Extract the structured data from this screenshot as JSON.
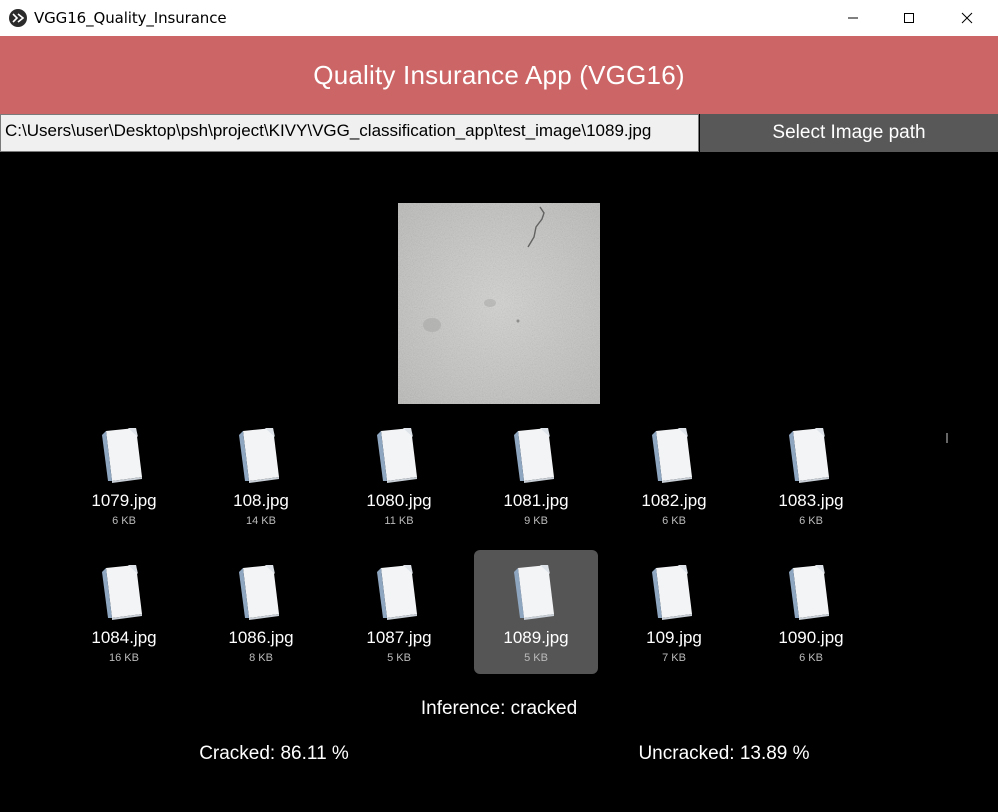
{
  "window": {
    "title": "VGG16_Quality_Insurance",
    "app_icon": "kivy-icon",
    "controls": [
      "minimize-icon",
      "maximize-icon",
      "close-icon"
    ]
  },
  "header": {
    "title": "Quality Insurance App (VGG16)",
    "background": "#cc6666"
  },
  "path_bar": {
    "value": "C:\\Users\\user\\Desktop\\psh\\project\\KIVY\\VGG_classification_app\\test_image\\1089.jpg",
    "button_label": "Select Image path"
  },
  "preview": {
    "icon": "concrete-texture-image"
  },
  "files": [
    {
      "name": "1079.jpg",
      "size": "6 KB",
      "selected": false
    },
    {
      "name": "108.jpg",
      "size": "14 KB",
      "selected": false
    },
    {
      "name": "1080.jpg",
      "size": "11 KB",
      "selected": false
    },
    {
      "name": "1081.jpg",
      "size": "9 KB",
      "selected": false
    },
    {
      "name": "1082.jpg",
      "size": "6 KB",
      "selected": false
    },
    {
      "name": "1083.jpg",
      "size": "6 KB",
      "selected": false
    },
    {
      "name": "1084.jpg",
      "size": "16 KB",
      "selected": false
    },
    {
      "name": "1086.jpg",
      "size": "8 KB",
      "selected": false
    },
    {
      "name": "1087.jpg",
      "size": "5 KB",
      "selected": false
    },
    {
      "name": "1089.jpg",
      "size": "5 KB",
      "selected": true
    },
    {
      "name": "109.jpg",
      "size": "7 KB",
      "selected": false
    },
    {
      "name": "1090.jpg",
      "size": "6 KB",
      "selected": false
    }
  ],
  "results": {
    "inference": "Inference: cracked",
    "cracked": "Cracked: 86.11 %",
    "uncracked": "Uncracked: 13.89 %"
  }
}
